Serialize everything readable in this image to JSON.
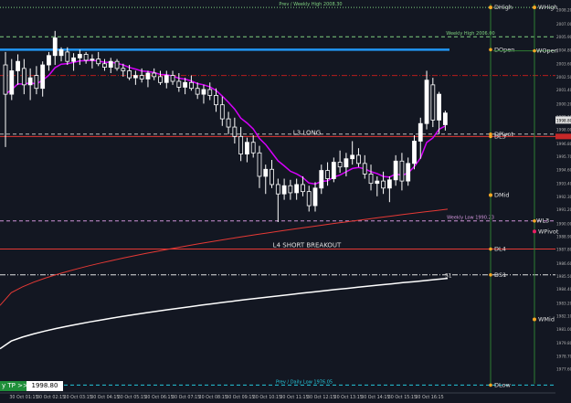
{
  "chart_data": {
    "type": "candlestick",
    "symbol_timeframe": "M15",
    "ylim": [
      1976.0,
      2008.8
    ],
    "price_ticks": [
      "2008.20",
      "2007.00",
      "2005.90",
      "2004.80",
      "2003.60",
      "2002.50",
      "2001.40",
      "2000.20",
      "1999.10",
      "1998.80",
      "1998.00",
      "1996.80",
      "1995.70",
      "1994.60",
      "1993.40",
      "1992.30",
      "1991.20",
      "1990.00",
      "1988.90",
      "1987.80",
      "1986.60",
      "1985.50",
      "1984.40",
      "1983.20",
      "1982.10",
      "1981.00",
      "1979.80",
      "1978.70",
      "1977.60"
    ],
    "current_price": "1998.80",
    "time_labels": [
      "30 Oct 01:15",
      "30 Oct 02:15",
      "30 Oct 03:15",
      "30 Oct 04:15",
      "30 Oct 05:15",
      "30 Oct 06:15",
      "30 Oct 07:15",
      "30 Oct 08:15",
      "30 Oct 09:15",
      "30 Oct 10:15",
      "30 Oct 11:15",
      "30 Oct 12:15",
      "30 Oct 13:15",
      "30 Oct 14:15",
      "30 Oct 15:15",
      "30 Oct 16:15"
    ],
    "candles": [
      {
        "o": 2003.5,
        "h": 2004.6,
        "l": 1996.5,
        "c": 2001.0
      },
      {
        "o": 2001.0,
        "h": 2004.0,
        "l": 2000.5,
        "c": 2003.0
      },
      {
        "o": 2003.0,
        "h": 2004.4,
        "l": 2001.8,
        "c": 2003.8
      },
      {
        "o": 2003.2,
        "h": 2004.0,
        "l": 2001.0,
        "c": 2001.8
      },
      {
        "o": 2001.8,
        "h": 2003.2,
        "l": 2000.5,
        "c": 2002.4
      },
      {
        "o": 2002.6,
        "h": 2003.4,
        "l": 2001.0,
        "c": 2001.5
      },
      {
        "o": 2001.5,
        "h": 2003.8,
        "l": 2000.8,
        "c": 2003.5
      },
      {
        "o": 2003.5,
        "h": 2004.6,
        "l": 2003.0,
        "c": 2004.3
      },
      {
        "o": 2004.3,
        "h": 2006.4,
        "l": 2003.5,
        "c": 2005.8
      },
      {
        "o": 2004.3,
        "h": 2005.0,
        "l": 2003.8,
        "c": 2004.8
      },
      {
        "o": 2004.6,
        "h": 2005.0,
        "l": 2003.5,
        "c": 2003.8
      },
      {
        "o": 2003.8,
        "h": 2004.5,
        "l": 2003.0,
        "c": 2004.1
      },
      {
        "o": 2004.1,
        "h": 2004.8,
        "l": 2003.5,
        "c": 2004.4
      },
      {
        "o": 2004.4,
        "h": 2004.6,
        "l": 2003.6,
        "c": 2003.9
      },
      {
        "o": 2003.9,
        "h": 2004.4,
        "l": 2003.2,
        "c": 2004.0
      },
      {
        "o": 2004.0,
        "h": 2004.6,
        "l": 2003.4,
        "c": 2003.6
      },
      {
        "o": 2003.6,
        "h": 2004.0,
        "l": 2003.0,
        "c": 2003.3
      },
      {
        "o": 2003.3,
        "h": 2004.1,
        "l": 2002.8,
        "c": 2003.8
      },
      {
        "o": 2003.8,
        "h": 2004.0,
        "l": 2003.0,
        "c": 2003.2
      },
      {
        "o": 2003.2,
        "h": 2003.6,
        "l": 2002.5,
        "c": 2003.0
      },
      {
        "o": 2003.0,
        "h": 2003.5,
        "l": 2002.2,
        "c": 2002.4
      },
      {
        "o": 2002.4,
        "h": 2003.0,
        "l": 2001.8,
        "c": 2002.6
      },
      {
        "o": 2002.6,
        "h": 2003.2,
        "l": 2002.0,
        "c": 2002.3
      },
      {
        "o": 2002.3,
        "h": 2003.0,
        "l": 2001.6,
        "c": 2002.8
      },
      {
        "o": 2002.8,
        "h": 2003.2,
        "l": 2002.2,
        "c": 2002.5
      },
      {
        "o": 2002.5,
        "h": 2003.0,
        "l": 2001.8,
        "c": 2002.0
      },
      {
        "o": 2002.0,
        "h": 2003.0,
        "l": 2001.5,
        "c": 2002.6
      },
      {
        "o": 2002.6,
        "h": 2003.0,
        "l": 2001.8,
        "c": 2002.1
      },
      {
        "o": 2002.1,
        "h": 2002.8,
        "l": 2001.2,
        "c": 2001.6
      },
      {
        "o": 2001.6,
        "h": 2002.4,
        "l": 2001.0,
        "c": 2002.0
      },
      {
        "o": 2002.0,
        "h": 2002.6,
        "l": 2001.3,
        "c": 2001.5
      },
      {
        "o": 2001.5,
        "h": 2002.0,
        "l": 2000.6,
        "c": 2001.0
      },
      {
        "o": 2001.0,
        "h": 2001.8,
        "l": 2000.2,
        "c": 2001.4
      },
      {
        "o": 2001.4,
        "h": 2002.0,
        "l": 2000.5,
        "c": 2000.9
      },
      {
        "o": 2000.9,
        "h": 2001.5,
        "l": 1999.5,
        "c": 2000.1
      },
      {
        "o": 2000.1,
        "h": 2000.8,
        "l": 1998.3,
        "c": 1998.9
      },
      {
        "o": 1998.9,
        "h": 1999.5,
        "l": 1997.6,
        "c": 1998.2
      },
      {
        "o": 1998.2,
        "h": 1999.0,
        "l": 1996.8,
        "c": 1997.4
      },
      {
        "o": 1997.4,
        "h": 1998.2,
        "l": 1995.3,
        "c": 1995.9
      },
      {
        "o": 1995.9,
        "h": 1997.3,
        "l": 1995.2,
        "c": 1996.9
      },
      {
        "o": 1996.9,
        "h": 1997.5,
        "l": 1995.6,
        "c": 1996.0
      },
      {
        "o": 1996.0,
        "h": 1996.6,
        "l": 1993.0,
        "c": 1994.0
      },
      {
        "o": 1994.0,
        "h": 1995.0,
        "l": 1992.5,
        "c": 1994.6
      },
      {
        "o": 1994.6,
        "h": 1995.4,
        "l": 1993.0,
        "c": 1993.3
      },
      {
        "o": 1993.3,
        "h": 1993.8,
        "l": 1990.1,
        "c": 1992.5
      },
      {
        "o": 1992.5,
        "h": 1993.8,
        "l": 1992.0,
        "c": 1993.2
      },
      {
        "o": 1993.2,
        "h": 1993.7,
        "l": 1992.0,
        "c": 1992.6
      },
      {
        "o": 1992.6,
        "h": 1993.8,
        "l": 1992.0,
        "c": 1993.3
      },
      {
        "o": 1993.3,
        "h": 1994.0,
        "l": 1992.3,
        "c": 1992.7
      },
      {
        "o": 1992.7,
        "h": 1993.2,
        "l": 1991.0,
        "c": 1991.5
      },
      {
        "o": 1991.5,
        "h": 1993.5,
        "l": 1991.0,
        "c": 1993.0
      },
      {
        "o": 1993.0,
        "h": 1995.0,
        "l": 1992.5,
        "c": 1994.5
      },
      {
        "o": 1994.5,
        "h": 1995.2,
        "l": 1993.2,
        "c": 1993.8
      },
      {
        "o": 1993.8,
        "h": 1995.6,
        "l": 1993.5,
        "c": 1995.2
      },
      {
        "o": 1995.2,
        "h": 1996.2,
        "l": 1994.3,
        "c": 1994.8
      },
      {
        "o": 1994.8,
        "h": 1996.0,
        "l": 1994.0,
        "c": 1995.5
      },
      {
        "o": 1995.5,
        "h": 1997.0,
        "l": 1995.0,
        "c": 1995.8
      },
      {
        "o": 1995.8,
        "h": 1996.4,
        "l": 1994.8,
        "c": 1995.1
      },
      {
        "o": 1995.1,
        "h": 1995.8,
        "l": 1993.8,
        "c": 1994.2
      },
      {
        "o": 1994.2,
        "h": 1995.0,
        "l": 1992.8,
        "c": 1993.4
      },
      {
        "o": 1993.4,
        "h": 1994.0,
        "l": 1992.3,
        "c": 1993.6
      },
      {
        "o": 1993.6,
        "h": 1994.4,
        "l": 1992.5,
        "c": 1993.0
      },
      {
        "o": 1993.0,
        "h": 1994.0,
        "l": 1991.8,
        "c": 1993.7
      },
      {
        "o": 1993.7,
        "h": 1995.8,
        "l": 1993.2,
        "c": 1995.3
      },
      {
        "o": 1995.3,
        "h": 1996.0,
        "l": 1992.8,
        "c": 1993.6
      },
      {
        "o": 1993.6,
        "h": 1995.6,
        "l": 1993.2,
        "c": 1995.1
      },
      {
        "o": 1995.1,
        "h": 1997.5,
        "l": 1994.6,
        "c": 1997.0
      },
      {
        "o": 1997.0,
        "h": 1999.0,
        "l": 1995.5,
        "c": 1998.5
      },
      {
        "o": 1998.5,
        "h": 2003.0,
        "l": 1998.0,
        "c": 2002.2
      },
      {
        "o": 2001.8,
        "h": 2002.4,
        "l": 1998.2,
        "c": 1998.8
      },
      {
        "o": 1998.8,
        "h": 2001.2,
        "l": 1997.6,
        "c": 2001.0
      },
      {
        "o": 1998.4,
        "h": 1999.6,
        "l": 1997.9,
        "c": 1999.4
      }
    ],
    "levels": [
      {
        "name": "WHigh",
        "price": 2008.4,
        "color": "#7fd07f",
        "style": "dotted",
        "label": "Prev / Weekly High 2008.30",
        "right_label": ""
      },
      {
        "name": "Weekly High",
        "price": 2005.9,
        "color": "#7fd07f",
        "style": "dashed",
        "label": "Weekly High 2006.00",
        "right_label": ""
      },
      {
        "name": "DOpen",
        "price": 2004.8,
        "color": "#2196f3",
        "style": "solid",
        "label": "",
        "right_label": "DOpen"
      },
      {
        "name": "WOpen",
        "price": 2004.7,
        "color": "#2e7d32",
        "style": "solid",
        "label": "",
        "right_label": "WOpen"
      },
      {
        "name": "R level",
        "price": 2002.6,
        "color": "#b71c1c",
        "style": "dashdot",
        "label": "",
        "right_label": ""
      },
      {
        "name": "DPivot",
        "price": 1997.6,
        "color": "#bdbdbd",
        "style": "dashed",
        "label": "",
        "right_label": "DPivot"
      },
      {
        "name": "DL3",
        "price": 1997.4,
        "color": "#e53935",
        "style": "solid",
        "label": "L3 LONG",
        "right_label": "DL3"
      },
      {
        "name": "WL3",
        "price": 1990.2,
        "color": "#ce93d8",
        "style": "dashed",
        "label": "Weekly Low 1990.23",
        "right_label": "WL3"
      },
      {
        "name": "DL4",
        "price": 1987.8,
        "color": "#e53935",
        "style": "solid",
        "label": "L4 SHORT BREAKOUT",
        "right_label": "DL4"
      },
      {
        "name": "DS1",
        "price": 1985.6,
        "color": "#e0e0e0",
        "style": "dashdot",
        "label": "",
        "right_label": "DS1"
      },
      {
        "name": "Daily Low",
        "price": 1976.2,
        "color": "#26c6da",
        "style": "dashed",
        "label": "Prev / Daily Low 1976.05",
        "right_label": "DLow"
      }
    ],
    "markers": [
      {
        "name": "DHigh",
        "price": 2008.4,
        "column": "D"
      },
      {
        "name": "DMid",
        "price": 1992.4,
        "column": "D"
      },
      {
        "name": "WHigh",
        "price": 2008.4,
        "column": "W"
      },
      {
        "name": "WPivot",
        "price": 1989.3,
        "column": "W"
      },
      {
        "name": "WMid",
        "price": 1981.8,
        "column": "W"
      }
    ],
    "s1_label": "S1",
    "indicator_colors": {
      "ema_fast": "#d500f9",
      "sma_slow": "#e53935",
      "sma_long": "#ffffff",
      "candle_up": "#ffffff",
      "candle_down": "#ffffff"
    }
  },
  "status": {
    "tp_label": "y TP >>",
    "price_box": "1998.80"
  }
}
